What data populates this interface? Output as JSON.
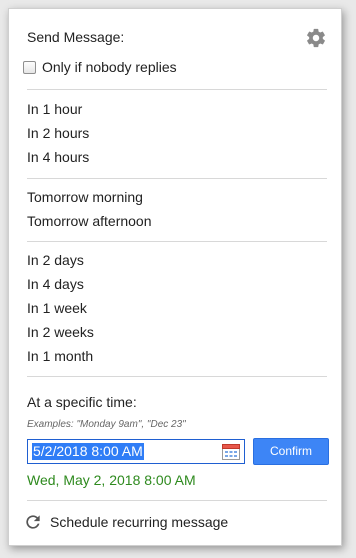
{
  "header": {
    "title": "Send Message:",
    "settings_icon": "gear-icon"
  },
  "only_if_no_reply": {
    "label": "Only if nobody replies",
    "checked": false
  },
  "groups": [
    [
      "In 1 hour",
      "In 2 hours",
      "In 4 hours"
    ],
    [
      "Tomorrow morning",
      "Tomorrow afternoon"
    ],
    [
      "In 2 days",
      "In 4 days",
      "In 1 week",
      "In 2 weeks",
      "In 1 month"
    ]
  ],
  "specific": {
    "label": "At a specific time:",
    "examples": "Examples: \"Monday 9am\", \"Dec 23\"",
    "input_value": "5/2/2018 8:00 AM",
    "calendar_icon": "calendar-icon",
    "confirm_label": "Confirm",
    "parsed": "Wed, May 2, 2018 8:00 AM"
  },
  "recurring": {
    "label": "Schedule recurring message",
    "icon": "refresh-icon"
  },
  "colors": {
    "accent": "#3d85f6",
    "selection": "#2f7df6",
    "success": "#2e8a1e",
    "divider": "#d8d8d8"
  }
}
